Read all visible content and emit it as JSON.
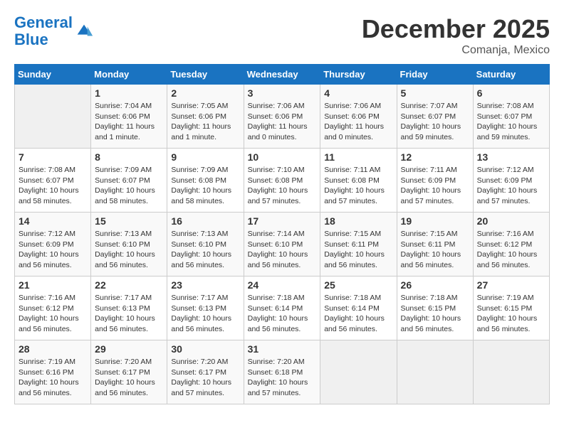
{
  "header": {
    "logo_line1": "General",
    "logo_line2": "Blue",
    "month": "December 2025",
    "location": "Comanja, Mexico"
  },
  "weekdays": [
    "Sunday",
    "Monday",
    "Tuesday",
    "Wednesday",
    "Thursday",
    "Friday",
    "Saturday"
  ],
  "weeks": [
    [
      {
        "day": "",
        "info": ""
      },
      {
        "day": "1",
        "info": "Sunrise: 7:04 AM\nSunset: 6:06 PM\nDaylight: 11 hours\nand 1 minute."
      },
      {
        "day": "2",
        "info": "Sunrise: 7:05 AM\nSunset: 6:06 PM\nDaylight: 11 hours\nand 1 minute."
      },
      {
        "day": "3",
        "info": "Sunrise: 7:06 AM\nSunset: 6:06 PM\nDaylight: 11 hours\nand 0 minutes."
      },
      {
        "day": "4",
        "info": "Sunrise: 7:06 AM\nSunset: 6:06 PM\nDaylight: 11 hours\nand 0 minutes."
      },
      {
        "day": "5",
        "info": "Sunrise: 7:07 AM\nSunset: 6:07 PM\nDaylight: 10 hours\nand 59 minutes."
      },
      {
        "day": "6",
        "info": "Sunrise: 7:08 AM\nSunset: 6:07 PM\nDaylight: 10 hours\nand 59 minutes."
      }
    ],
    [
      {
        "day": "7",
        "info": "Sunrise: 7:08 AM\nSunset: 6:07 PM\nDaylight: 10 hours\nand 58 minutes."
      },
      {
        "day": "8",
        "info": "Sunrise: 7:09 AM\nSunset: 6:07 PM\nDaylight: 10 hours\nand 58 minutes."
      },
      {
        "day": "9",
        "info": "Sunrise: 7:09 AM\nSunset: 6:08 PM\nDaylight: 10 hours\nand 58 minutes."
      },
      {
        "day": "10",
        "info": "Sunrise: 7:10 AM\nSunset: 6:08 PM\nDaylight: 10 hours\nand 57 minutes."
      },
      {
        "day": "11",
        "info": "Sunrise: 7:11 AM\nSunset: 6:08 PM\nDaylight: 10 hours\nand 57 minutes."
      },
      {
        "day": "12",
        "info": "Sunrise: 7:11 AM\nSunset: 6:09 PM\nDaylight: 10 hours\nand 57 minutes."
      },
      {
        "day": "13",
        "info": "Sunrise: 7:12 AM\nSunset: 6:09 PM\nDaylight: 10 hours\nand 57 minutes."
      }
    ],
    [
      {
        "day": "14",
        "info": "Sunrise: 7:12 AM\nSunset: 6:09 PM\nDaylight: 10 hours\nand 56 minutes."
      },
      {
        "day": "15",
        "info": "Sunrise: 7:13 AM\nSunset: 6:10 PM\nDaylight: 10 hours\nand 56 minutes."
      },
      {
        "day": "16",
        "info": "Sunrise: 7:13 AM\nSunset: 6:10 PM\nDaylight: 10 hours\nand 56 minutes."
      },
      {
        "day": "17",
        "info": "Sunrise: 7:14 AM\nSunset: 6:10 PM\nDaylight: 10 hours\nand 56 minutes."
      },
      {
        "day": "18",
        "info": "Sunrise: 7:15 AM\nSunset: 6:11 PM\nDaylight: 10 hours\nand 56 minutes."
      },
      {
        "day": "19",
        "info": "Sunrise: 7:15 AM\nSunset: 6:11 PM\nDaylight: 10 hours\nand 56 minutes."
      },
      {
        "day": "20",
        "info": "Sunrise: 7:16 AM\nSunset: 6:12 PM\nDaylight: 10 hours\nand 56 minutes."
      }
    ],
    [
      {
        "day": "21",
        "info": "Sunrise: 7:16 AM\nSunset: 6:12 PM\nDaylight: 10 hours\nand 56 minutes."
      },
      {
        "day": "22",
        "info": "Sunrise: 7:17 AM\nSunset: 6:13 PM\nDaylight: 10 hours\nand 56 minutes."
      },
      {
        "day": "23",
        "info": "Sunrise: 7:17 AM\nSunset: 6:13 PM\nDaylight: 10 hours\nand 56 minutes."
      },
      {
        "day": "24",
        "info": "Sunrise: 7:18 AM\nSunset: 6:14 PM\nDaylight: 10 hours\nand 56 minutes."
      },
      {
        "day": "25",
        "info": "Sunrise: 7:18 AM\nSunset: 6:14 PM\nDaylight: 10 hours\nand 56 minutes."
      },
      {
        "day": "26",
        "info": "Sunrise: 7:18 AM\nSunset: 6:15 PM\nDaylight: 10 hours\nand 56 minutes."
      },
      {
        "day": "27",
        "info": "Sunrise: 7:19 AM\nSunset: 6:15 PM\nDaylight: 10 hours\nand 56 minutes."
      }
    ],
    [
      {
        "day": "28",
        "info": "Sunrise: 7:19 AM\nSunset: 6:16 PM\nDaylight: 10 hours\nand 56 minutes."
      },
      {
        "day": "29",
        "info": "Sunrise: 7:20 AM\nSunset: 6:17 PM\nDaylight: 10 hours\nand 56 minutes."
      },
      {
        "day": "30",
        "info": "Sunrise: 7:20 AM\nSunset: 6:17 PM\nDaylight: 10 hours\nand 57 minutes."
      },
      {
        "day": "31",
        "info": "Sunrise: 7:20 AM\nSunset: 6:18 PM\nDaylight: 10 hours\nand 57 minutes."
      },
      {
        "day": "",
        "info": ""
      },
      {
        "day": "",
        "info": ""
      },
      {
        "day": "",
        "info": ""
      }
    ]
  ]
}
